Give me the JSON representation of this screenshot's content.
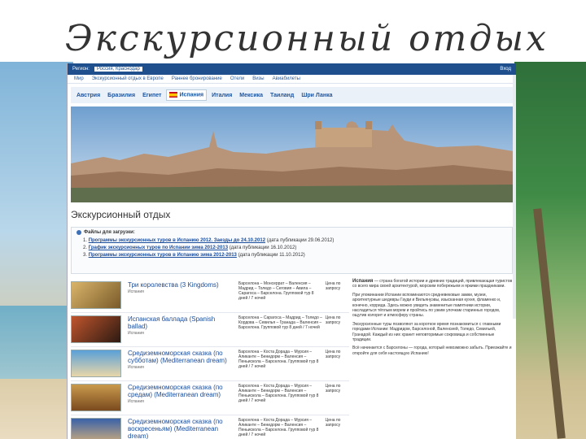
{
  "slide": {
    "title": "Экскурсионный отдых"
  },
  "topbar": {
    "region_label": "Регион:",
    "region_value": "Россия, Краснодар",
    "login": "Вход"
  },
  "subnav": {
    "items": [
      "Мир",
      "Экскурсионный отдых в Европе",
      "Раннее бронирование",
      "Отели",
      "Визы",
      "Авиабилеты"
    ]
  },
  "countries": [
    "Австрия",
    "Бразилия",
    "Египет",
    "Испания",
    "Италия",
    "Мексика",
    "Таиланд",
    "Шри Ланка"
  ],
  "active_country": "Испания",
  "page": {
    "title": "Экскурсионный отдых",
    "files_header": "Файлы для загрузки:",
    "files": [
      {
        "num": "1.",
        "link": "Программы экскурсионных туров в Испанию 2012. Заезды до 24.10.2012",
        "note": "(дата публикации 29.06.2012)"
      },
      {
        "num": "2.",
        "link": "График экскурсионных туров по Испании зима 2012-2013",
        "note": "(дата публикации 16.10.2012)"
      },
      {
        "num": "3.",
        "link": "Программы экскурсионных туров в Испанию зима 2012-2013",
        "note": "(дата публикации 11.10.2012)"
      }
    ]
  },
  "tours": [
    {
      "name": "Три королевства (3 Kingdoms)",
      "sub": "Испания",
      "route": "Барселона – Монсеррат – Валенсия – Мадрид – Толедо – Сеговия – Авила – Сарагоса – Барселона. Групповой тур 8 дней / 7 ночей",
      "price": "Цена по запросу"
    },
    {
      "name": "Испанская баллада (Spanish ballad)",
      "sub": "Испания",
      "route": "Барселона – Сарагоса – Мадрид – Толедо – Кордова – Севилья – Гранада – Валенсия – Барселона. Групповой тур 8 дней / 7 ночей",
      "price": "Цена по запросу"
    },
    {
      "name": "Средиземноморская сказка (по субботам) (Mediterranean dream)",
      "sub": "Испания",
      "route": "Барселона – Коста Дорада – Мурсия – Аликанте – Бенидорм – Валенсия – Пеньискола – Барселона. Групповой тур 8 дней / 7 ночей",
      "price": "Цена по запросу"
    },
    {
      "name": "Средиземноморская сказка (по средам) (Mediterranean dream)",
      "sub": "Испания",
      "route": "Барселона – Коста Дорада – Мурсия – Аликанте – Бенидорм – Валенсия – Пеньискола – Барселона. Групповой тур 8 дней / 7 ночей",
      "price": "Цена по запросу"
    },
    {
      "name": "Средиземноморская сказка (по воскресеньям) (Mediterranean dream)",
      "sub": "Испания",
      "route": "Барселона – Коста Дорада – Мурсия – Аликанте – Бенидорм – Валенсия – Пеньискола – Барселона. Групповой тур 8 дней / 7 ночей",
      "price": "Цена по запросу"
    }
  ],
  "description": {
    "lead_bold": "Испания",
    "lead": " — страна богатой истории и древних традиций, привлекающая туристов со всего мира своей архитектурой, морским побережьем и яркими праздниками.",
    "p2": "При упоминании Испании вспоминаются средневековые замки, музеи, архитектурные шедевры Гауди и Вильянуэвы, изысканная кухня, фламенко и, конечно, коррида. Здесь можно увидеть знаменитые памятники истории, насладиться тёплым морем и пройтись по узким улочкам старинных городов, ощутив колорит и атмосферу страны.",
    "p3": "Экскурсионные туры позволяют за короткое время познакомиться с главными городами Испании: Мадридом, Барселоной, Валенсией, Толедо, Севильей, Гранадой. Каждый из них хранит неповторимые сокровища и собственные традиции.",
    "p4": "Всё начинается с Барселоны — города, который невозможно забыть. Приезжайте и откройте для себя настоящую Испанию!"
  }
}
